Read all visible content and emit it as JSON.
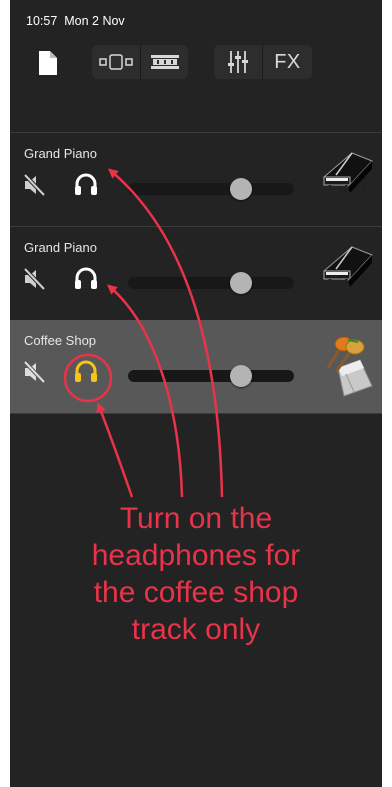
{
  "status_bar": {
    "time": "10:57",
    "date": "Mon 2 Nov"
  },
  "toolbar": {
    "buttons": [
      "document-icon",
      "tracks-view-icon",
      "mixer-view-icon",
      "eq-sliders-icon",
      "fx"
    ],
    "fx_label": "FX"
  },
  "tracks": [
    {
      "name": "Grand Piano",
      "instrument": "grand-piano",
      "muted": false,
      "solo": false,
      "volume": 0.71,
      "selected": false
    },
    {
      "name": "Grand Piano",
      "instrument": "grand-piano",
      "muted": false,
      "solo": false,
      "volume": 0.71,
      "selected": false
    },
    {
      "name": "Coffee Shop",
      "instrument": "maracas-cowbell",
      "muted": false,
      "solo": true,
      "volume": 0.71,
      "selected": true
    }
  ],
  "colors": {
    "background": "#232323",
    "selected_track": "#585858",
    "solo_active": "#f5c518",
    "annotation": "#e8334a"
  },
  "annotation": {
    "lines": [
      "Turn on the",
      "headphones for",
      "the coffee shop",
      "track only"
    ]
  }
}
